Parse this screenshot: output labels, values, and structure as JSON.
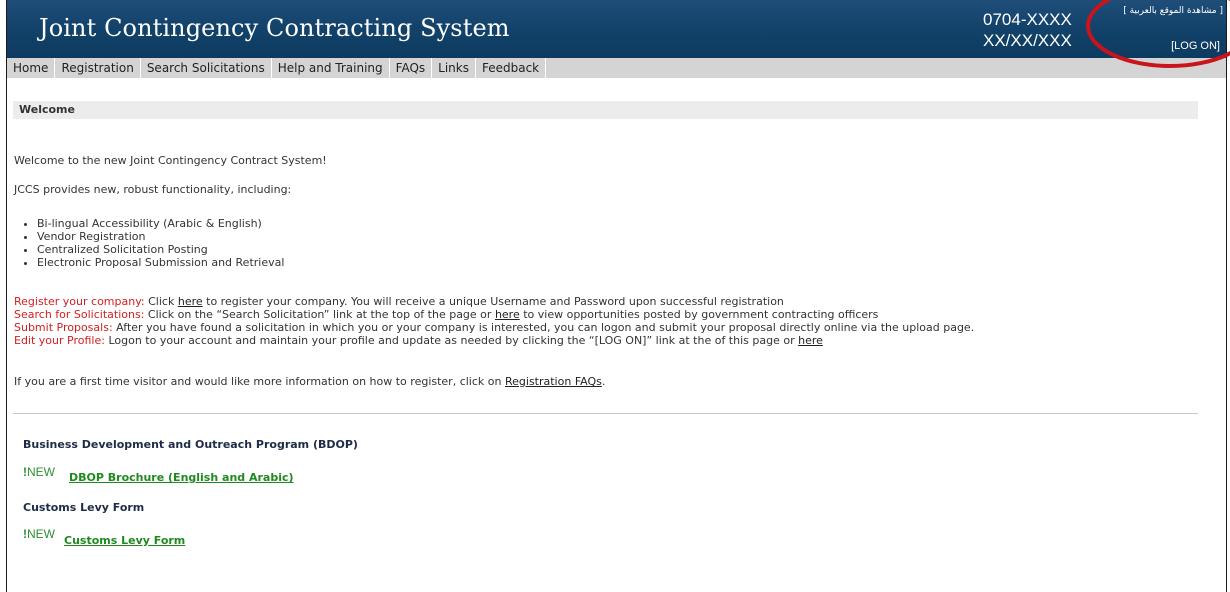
{
  "header": {
    "title": "Joint Contingency Contracting System",
    "phone": "0704-XXXX",
    "date": "XX/XX/XXX",
    "lang_link": "[ مشاهدة الموقع بالعربية ]",
    "logon": "[LOG ON]"
  },
  "nav": {
    "items": [
      "Home",
      "Registration",
      "Search Solicitations",
      "Help and Training",
      "FAQs",
      "Links",
      "Feedback"
    ]
  },
  "welcome": {
    "heading": "Welcome",
    "intro": "Welcome to the new Joint Contingency Contract System!",
    "functionality_lead": "JCCS provides new, robust functionality, including:",
    "features": [
      "Bi-lingual Accessibility (Arabic & English)",
      "Vendor Registration",
      "Centralized Solicitation Posting",
      "Electronic Proposal Submission and Retrieval"
    ],
    "register": {
      "label": "Register your company:",
      "pre": " Click ",
      "link": "here",
      "post": " to register your company. You will receive a unique Username and Password upon successful registration"
    },
    "search": {
      "label": "Search for Solicitations:",
      "pre": " Click on the “Search Solicitation” link at the top of the page or ",
      "link": "here",
      "post": " to view opportunities posted by government contracting officers"
    },
    "submit": {
      "label": "Submit Proposals:",
      "text": " After you have found a solicitation in which you or your company is interested, you can logon and submit your proposal directly online via the upload page."
    },
    "edit": {
      "label": "Edit your Profile:",
      "pre": " Logon to your account and maintain your profile and update as needed by clicking the “[LOG ON]” link at the of this page or ",
      "link": "here"
    },
    "first_time": {
      "pre": "If you are a first time visitor and would like more information on how to register, click on ",
      "link": "Registration FAQs",
      "post": "."
    }
  },
  "bdop": {
    "heading": "Business Development and Outreach Program (BDOP)",
    "badge_mark": "!",
    "badge_text": "NEW",
    "link": "DBOP Brochure (English and Arabic)"
  },
  "customs": {
    "heading": "Customs Levy Form",
    "badge_mark": "!",
    "badge_text": "NEW",
    "link": "Customs Levy Form"
  },
  "colors": {
    "banner": "#13436b",
    "nav": "#d4d4d4",
    "label_red": "#d21f1f",
    "new_green": "#2f8f2f",
    "highlight": "#c8141a"
  }
}
